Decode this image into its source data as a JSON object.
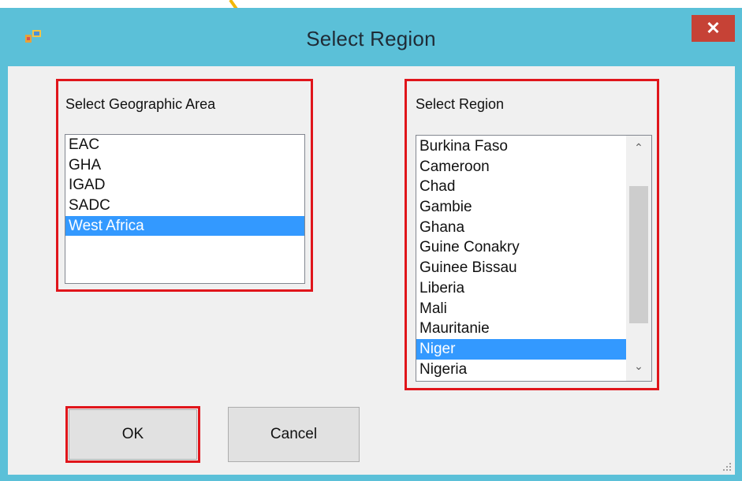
{
  "window": {
    "title": "Select Region",
    "close_symbol": "✕"
  },
  "area_group": {
    "label": "Select Geographic Area",
    "items": [
      "EAC",
      "GHA",
      "IGAD",
      "SADC",
      "West Africa"
    ],
    "selected_index": 4
  },
  "region_group": {
    "label": "Select Region",
    "items": [
      "Burkina Faso",
      "Cameroon",
      "Chad",
      "Gambie",
      "Ghana",
      "Guine Conakry",
      "Guinee Bissau",
      "Liberia",
      "Mali",
      "Mauritanie",
      "Niger",
      "Nigeria"
    ],
    "selected_index": 10,
    "scroll_up_symbol": "⌃",
    "scroll_down_symbol": "⌄"
  },
  "buttons": {
    "ok": "OK",
    "cancel": "Cancel"
  },
  "colors": {
    "highlight_box": "#e0151b",
    "selection": "#3399ff",
    "title_bar": "#5bc0d8",
    "close_button": "#c64236"
  }
}
